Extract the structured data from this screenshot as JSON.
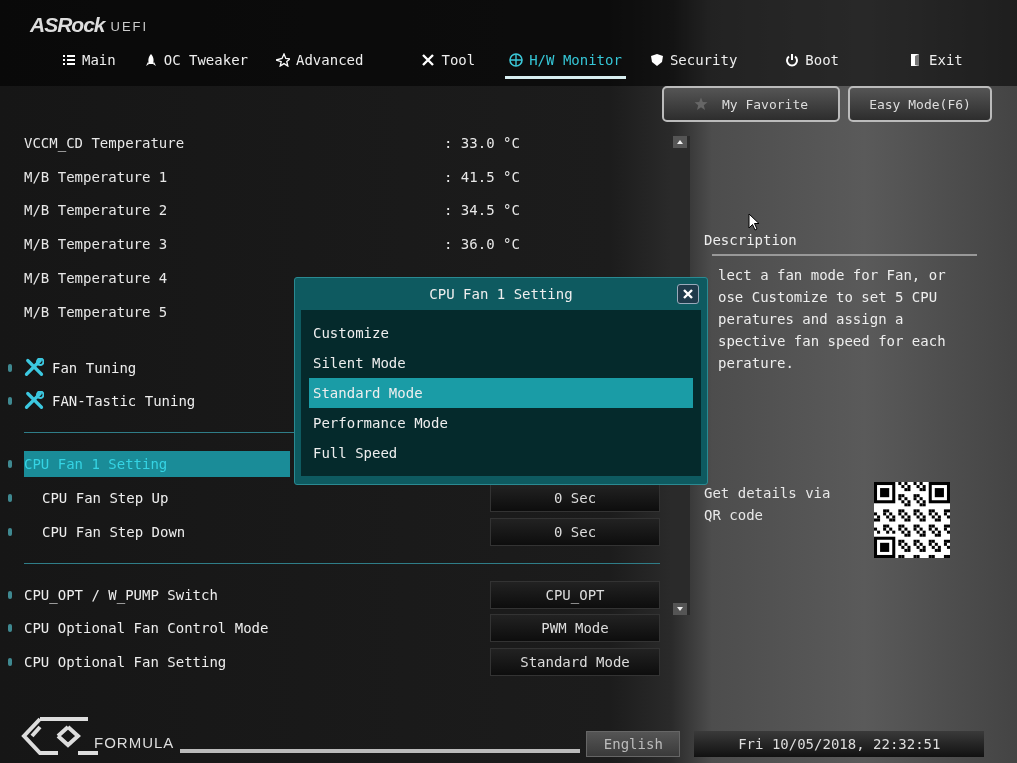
{
  "brand": {
    "logo": "ASRock",
    "suffix": "UEFI"
  },
  "tabs": [
    {
      "label": "Main",
      "selected": false
    },
    {
      "label": "OC Tweaker",
      "selected": false
    },
    {
      "label": "Advanced",
      "selected": false
    },
    {
      "label": "Tool",
      "selected": false
    },
    {
      "label": "H/W Monitor",
      "selected": true
    },
    {
      "label": "Security",
      "selected": false
    },
    {
      "label": "Boot",
      "selected": false
    },
    {
      "label": "Exit",
      "selected": false
    }
  ],
  "top_buttons": [
    {
      "label": "My Favorite",
      "kind": "favorite"
    },
    {
      "label": "Easy Mode(F6)",
      "kind": "plain"
    }
  ],
  "items": [
    {
      "kind": "reading",
      "label": "VCCM_CD Temperature",
      "value": ": 33.0 °C"
    },
    {
      "kind": "reading",
      "label": "M/B Temperature 1",
      "value": ": 41.5 °C"
    },
    {
      "kind": "reading",
      "label": "M/B Temperature 2",
      "value": ": 34.5 °C"
    },
    {
      "kind": "reading",
      "label": "M/B Temperature 3",
      "value": ": 36.0 °C"
    },
    {
      "kind": "reading",
      "label": "M/B Temperature 4"
    },
    {
      "kind": "reading",
      "label": "M/B Temperature 5"
    },
    {
      "kind": "gap"
    },
    {
      "kind": "submenu",
      "label": "Fan Tuning"
    },
    {
      "kind": "submenu",
      "label": "FAN-Tastic Tuning"
    },
    {
      "kind": "divider"
    },
    {
      "kind": "setting",
      "label": "CPU Fan 1 Setting",
      "indent": false,
      "selected": true
    },
    {
      "kind": "setting",
      "label": "CPU Fan Step Up",
      "value": "0 Sec",
      "indent": true,
      "selected": false
    },
    {
      "kind": "setting",
      "label": "CPU Fan Step Down",
      "value": "0 Sec",
      "indent": true,
      "selected": false
    },
    {
      "kind": "divider"
    },
    {
      "kind": "setting",
      "label": "CPU_OPT / W_PUMP Switch",
      "value": "CPU_OPT",
      "indent": false,
      "selected": false
    },
    {
      "kind": "setting",
      "label": "CPU Optional Fan Control Mode",
      "value": "PWM Mode",
      "indent": false,
      "selected": false
    },
    {
      "kind": "setting",
      "label": "CPU Optional Fan Setting",
      "value": "Standard Mode",
      "indent": false,
      "selected": false
    }
  ],
  "description": {
    "title": "Description",
    "lines": [
      "lect a fan mode for Fan, or",
      "ose Customize to set 5 CPU",
      "peratures and assign a",
      "spective fan speed for each",
      "perature."
    ]
  },
  "qr": {
    "text": "Get details via QR code"
  },
  "dialog": {
    "title": "CPU Fan 1 Setting",
    "options": [
      {
        "label": "Customize",
        "selected": false
      },
      {
        "label": "Silent Mode",
        "selected": false
      },
      {
        "label": "Standard Mode",
        "selected": true
      },
      {
        "label": "Performance Mode",
        "selected": false
      },
      {
        "label": "Full Speed",
        "selected": false
      }
    ]
  },
  "footer": {
    "logo": "FORMULA",
    "language": "English",
    "datetime": "Fri 10/05/2018, 22:32:51"
  }
}
